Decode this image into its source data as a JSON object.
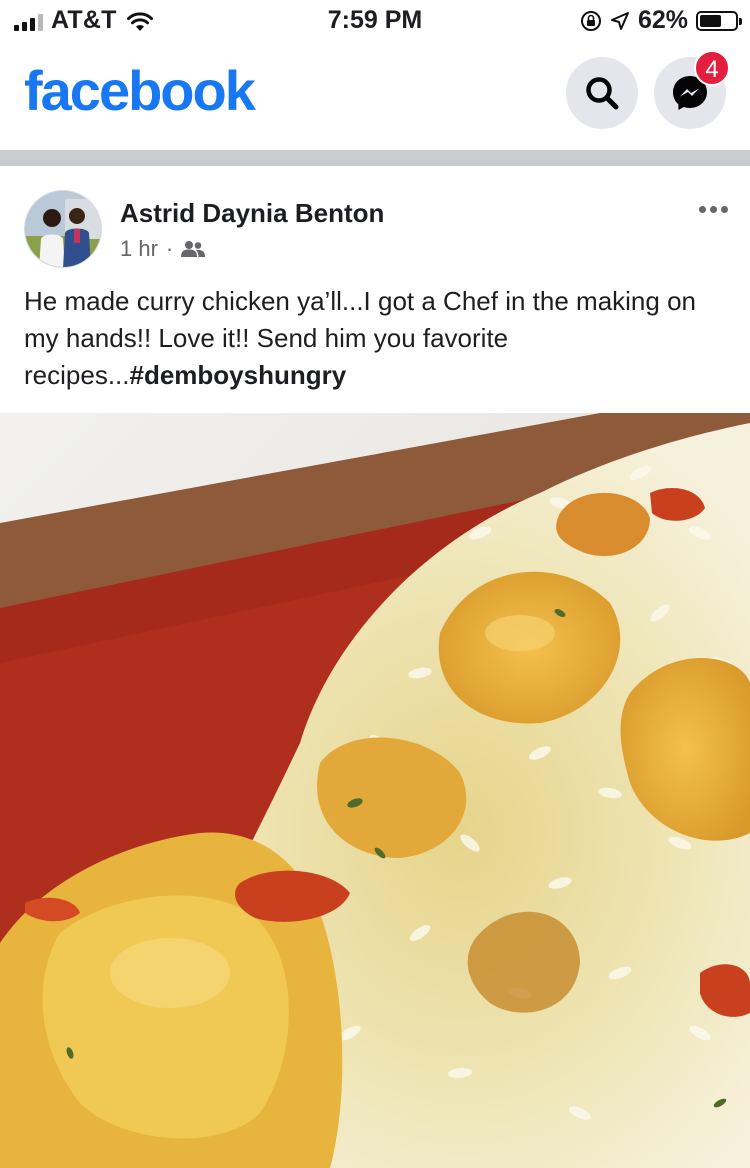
{
  "status_bar": {
    "carrier": "AT&T",
    "time": "7:59 PM",
    "battery_percent": "62%",
    "battery_level": 0.62
  },
  "header": {
    "logo": "facebook",
    "search_icon": "search-icon",
    "messenger_icon": "messenger-icon",
    "messenger_badge": "4"
  },
  "post": {
    "author": "Astrid Daynia Benton",
    "time": "1 hr",
    "separator": "·",
    "audience_icon": "friends-icon",
    "more_icon": "more-horizontal-icon",
    "text": "He made curry chicken ya’ll...I got a Chef in the making on my hands!! Love it!! Send him you favorite recipes...",
    "hashtag": "#demboyshungry",
    "photo_icon": "food-photo"
  },
  "colors": {
    "brand": "#1877f2",
    "badge": "#e41e3f",
    "plate": "#a52a1c",
    "rice": "#efe6b8"
  }
}
